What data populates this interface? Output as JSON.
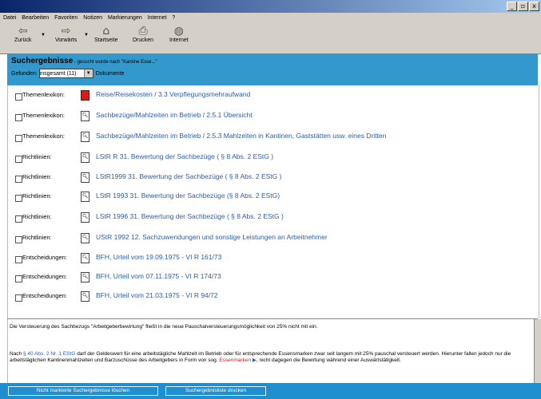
{
  "window": {
    "min": "_",
    "max": "▫",
    "close": "x"
  },
  "menu": [
    "Datei",
    "Bearbeiten",
    "Favoriten",
    "Notizen",
    "Markierungen",
    "Internet",
    "?"
  ],
  "toolbar": {
    "back": "Zurück",
    "forward": "Vorwärts",
    "home": "Startseite",
    "print": "Drucken",
    "internet": "Internet"
  },
  "header": {
    "title": "Suchergebnisse",
    "subtitle": " - gesucht wurde nach \"Kantine Esse...\"",
    "found_label": "Gefunden:",
    "found_value": "insgesamt (11)",
    "documents_label": "Dokumente"
  },
  "results": [
    {
      "category": "Themenlexikon:",
      "title": "Reise/Reisekosten / 3.3 Verpflegungsmehraufwand",
      "icon": "red-document-icon"
    },
    {
      "category": "Themenlexikon:",
      "title": "Sachbezüge/Mahlzeiten im Betrieb / 2.5.1 Übersicht",
      "icon": "document-icon"
    },
    {
      "category": "Themenlexikon:",
      "title": "Sachbezüge/Mahlzeiten im Betrieb / 2.5.3 Mahlzeiten in Kantinen, Gaststätten usw. eines Dritten",
      "icon": "document-icon"
    },
    {
      "category": "Richtlinien:",
      "title": "LStR R 31. Bewertung der Sachbezüge ( § 8 Abs. 2 EStG )",
      "icon": "document-icon"
    },
    {
      "category": "Richtlinien:",
      "title": "LStR1999 31. Bewertung der Sachbezüge ( § 8 Abs. 2 EStG )",
      "icon": "document-icon"
    },
    {
      "category": "Richtlinien:",
      "title": "LStR 1993 31. Bewertung der Sachbezüge (§ 8 Abs. 2 EStG)",
      "icon": "document-icon"
    },
    {
      "category": "Richtlinien:",
      "title": "LStR 1996 31. Bewertung der Sachbezüge ( § 8 Abs. 2 EStG )",
      "icon": "document-icon"
    },
    {
      "category": "Richtlinien:",
      "title": "UStR 1992 12. Sachzuwendungen und sonstige Leistungen an Arbeitnehmer",
      "icon": "document-icon"
    },
    {
      "category": "Entscheidungen:",
      "title": "BFH, Urteil vom 19.09.1975 - VI R 161/73",
      "icon": "document-icon"
    },
    {
      "category": "Entscheidungen:",
      "title": "BFH, Urteil vom 07.11.1975 - VI R 174/73",
      "icon": "document-icon"
    },
    {
      "category": "Entscheidungen:",
      "title": "BFH, Urteil vom 21.03.1975 - VI R 94/72",
      "icon": "document-icon"
    }
  ],
  "info": {
    "p1": "Die Versteuerung des Sachbezugs \"Arbeitgeberbewirtung\" fließt in die neue Pauschalversteuerungsmöglichkeit von 25% nicht mit ein.",
    "p2_pre": "Nach ",
    "p2_link": "§ 40 Abs. 2 Nr. 1 EStG",
    "p2_mid": " darf der Geldeswert für eine arbeitstägliche Mahlzeit im Betrieb oder für entsprechende Essensmarken zwar seit langem mit 25% pauschal versteuert werden. Hierunter fallen jedoch nur die arbeitstäglichen Kantinenmahlzeiten und Barzuschüsse des Arbeitgebers in Form von sog. ",
    "p2_link2": "Essenmarken",
    "p2_post": ", nicht dagegen die Bewirtung während einer Auswärtstätigkeit."
  },
  "footer": {
    "delete_button": "Nicht markierte Suchergebnisse löschen",
    "print_button": "Suchergebnisliste drucken"
  },
  "colors": {
    "header_bg": "#3399cc",
    "link": "#2a5db0",
    "footer_bg": "#1f8fcf"
  }
}
